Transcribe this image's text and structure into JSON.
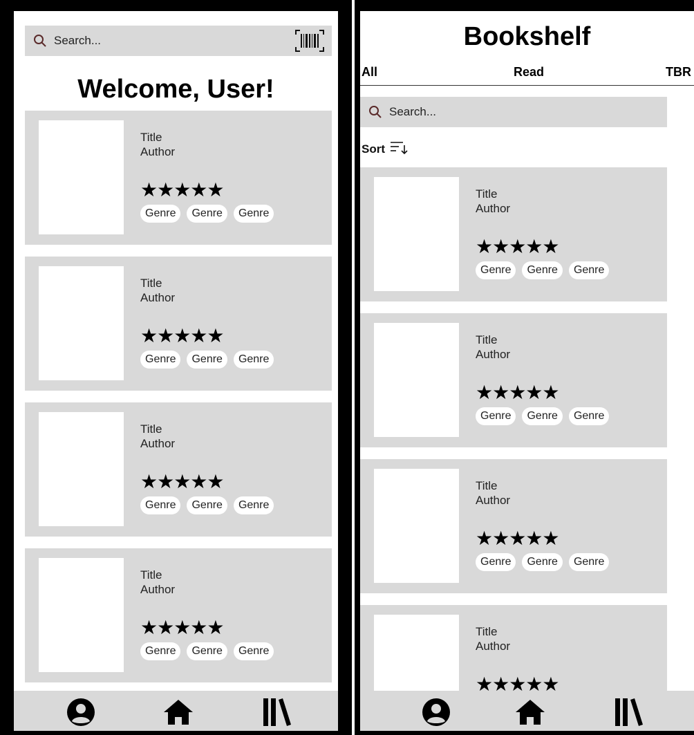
{
  "home": {
    "search": {
      "placeholder": "Search..."
    },
    "welcome": "Welcome, User!",
    "books": [
      {
        "title": "Title",
        "author": "Author",
        "rating": "★★★★★",
        "genres": [
          "Genre",
          "Genre",
          "Genre"
        ]
      },
      {
        "title": "Title",
        "author": "Author",
        "rating": "★★★★★",
        "genres": [
          "Genre",
          "Genre",
          "Genre"
        ]
      },
      {
        "title": "Title",
        "author": "Author",
        "rating": "★★★★★",
        "genres": [
          "Genre",
          "Genre",
          "Genre"
        ]
      },
      {
        "title": "Title",
        "author": "Author",
        "rating": "★★★★★",
        "genres": [
          "Genre",
          "Genre",
          "Genre"
        ]
      }
    ]
  },
  "bookshelf": {
    "title": "Bookshelf",
    "tabs": [
      "All",
      "Read",
      "TBR"
    ],
    "search": {
      "placeholder": "Search..."
    },
    "sort_label": "Sort",
    "books": [
      {
        "title": "Title",
        "author": "Author",
        "rating": "★★★★★",
        "genres": [
          "Genre",
          "Genre",
          "Genre"
        ]
      },
      {
        "title": "Title",
        "author": "Author",
        "rating": "★★★★★",
        "genres": [
          "Genre",
          "Genre",
          "Genre"
        ]
      },
      {
        "title": "Title",
        "author": "Author",
        "rating": "★★★★★",
        "genres": [
          "Genre",
          "Genre",
          "Genre"
        ]
      },
      {
        "title": "Title",
        "author": "Author",
        "rating": "★★★★★",
        "genres": []
      }
    ]
  },
  "nav": {
    "icons": [
      "user-circle-icon",
      "home-icon",
      "library-icon"
    ]
  },
  "colors": {
    "panel": "#d9d9d9",
    "frame": "#000000",
    "search_icon": "#5a2a2a"
  }
}
